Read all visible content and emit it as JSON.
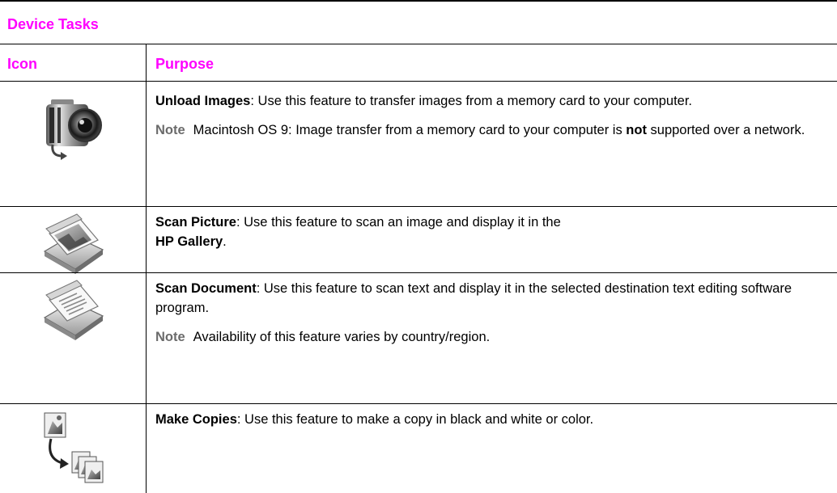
{
  "table": {
    "caption": "Device Tasks",
    "headers": {
      "icon": "Icon",
      "purpose": "Purpose"
    },
    "rows": [
      {
        "icon_name": "camera-unload-icon",
        "title": "Unload Images",
        "text": ": Use this feature to transfer images from a memory card to your computer.",
        "note": {
          "label": "Note",
          "text_a": "Macintosh OS 9: Image transfer from a memory card to your computer is ",
          "text_bold": "not",
          "text_b": " supported over a network."
        }
      },
      {
        "icon_name": "scan-picture-icon",
        "title": "Scan Picture",
        "text_a": ": Use this feature to scan an image and display it in the",
        "text_bold": "HP Gallery",
        "text_b": "."
      },
      {
        "icon_name": "scan-document-icon",
        "title": "Scan Document",
        "text": ": Use this feature to scan text and display it in the selected destination text editing software program.",
        "note": {
          "label": "Note",
          "text": "Availability of this feature varies by country/region."
        }
      },
      {
        "icon_name": "make-copies-icon",
        "title": "Make Copies",
        "text": ": Use this feature to make a copy in black and white or color."
      }
    ]
  },
  "colors": {
    "heading": "#ff00ff",
    "note_label": "#6b6b6b",
    "rule": "#000000"
  }
}
